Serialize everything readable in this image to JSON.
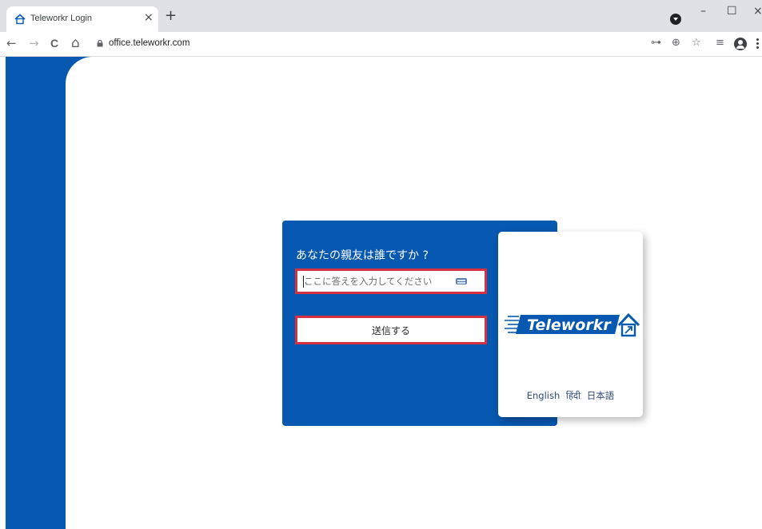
{
  "browser": {
    "tab": {
      "title": "Teleworkr Login",
      "close_glyph": "×",
      "icon": "home-icon"
    },
    "new_tab_glyph": "+",
    "nav": {
      "back": "←",
      "forward": "→",
      "reload": "C",
      "home": "⌂"
    },
    "url": "office.teleworkr.com",
    "window_controls": {
      "minimize": "–",
      "maximize": "☐",
      "close": "×"
    },
    "toolbar_icons": {
      "key": "⊶",
      "zoom": "⊕",
      "star": "☆",
      "reading_list": "≡"
    }
  },
  "colors": {
    "brand_blue": "#0758b0",
    "highlight_red": "#d7313f"
  },
  "login": {
    "question": "あなたの親友は誰ですか ?",
    "answer_placeholder": "ここに答えを入力してください",
    "answer_value": "",
    "submit_label": "送信する"
  },
  "brand": {
    "logo_text": "Teleworkr",
    "languages": [
      "English",
      "हिंदी",
      "日本語"
    ]
  }
}
